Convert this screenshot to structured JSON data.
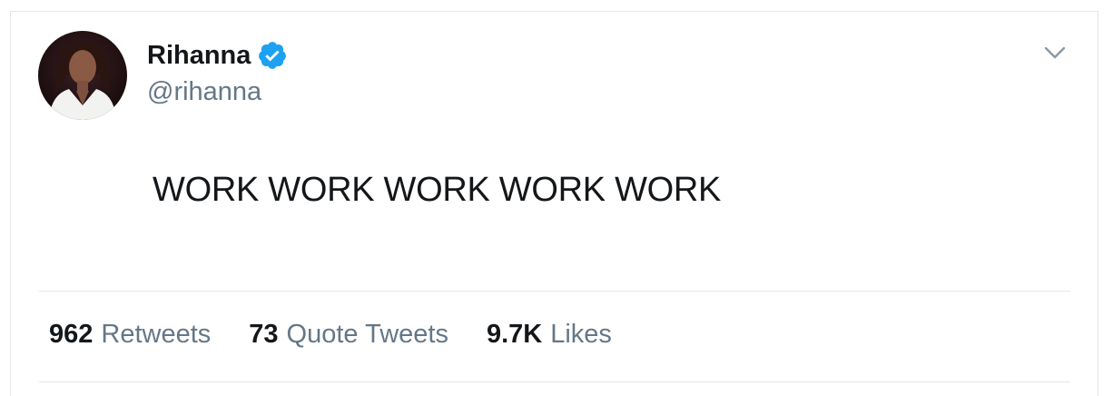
{
  "tweet": {
    "author": {
      "name": "Rihanna",
      "handle": "@rihanna",
      "verified": true,
      "avatar_icon": "profile-photo"
    },
    "text": "WORK WORK WORK WORK WORK",
    "menu_icon": "chevron-down-icon"
  },
  "stats": [
    {
      "count": "962",
      "label": "Retweets"
    },
    {
      "count": "73",
      "label": "Quote Tweets"
    },
    {
      "count": "9.7K",
      "label": "Likes"
    }
  ],
  "colors": {
    "verified_blue": "#1da1f2",
    "primary_text": "#14171a",
    "secondary_text": "#657786",
    "divider": "#e1e8ed"
  }
}
